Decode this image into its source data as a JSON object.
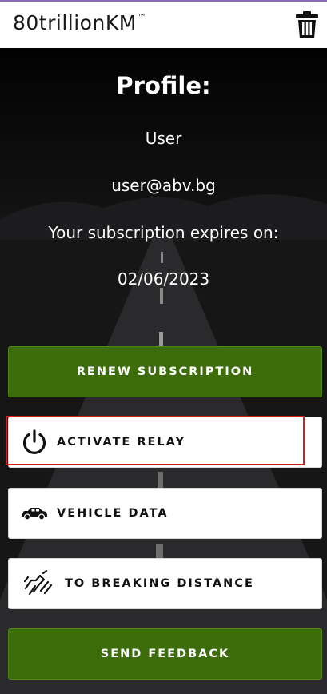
{
  "app": {
    "logo_text": "80trillionKM",
    "logo_tm": "™"
  },
  "profile": {
    "title": "Profile:",
    "username": "User",
    "email": "user@abv.bg",
    "subscription_label": "Your subscription expires on:",
    "expiry_date": "02/06/2023"
  },
  "buttons": {
    "renew": "RENEW SUBSCRIPTION",
    "activate_relay": "ACTIVATE RELAY",
    "vehicle_data": "VEHICLE DATA",
    "breaking_distance": "TO BREAKING DISTANCE",
    "feedback": "SEND FEEDBACK"
  },
  "icons": {
    "trash": "trash-icon",
    "power": "power-icon",
    "car": "car-icon",
    "braking": "braking-distance-icon"
  },
  "colors": {
    "accent_green": "#3d6c0b",
    "highlight_red": "#d61e1e"
  }
}
